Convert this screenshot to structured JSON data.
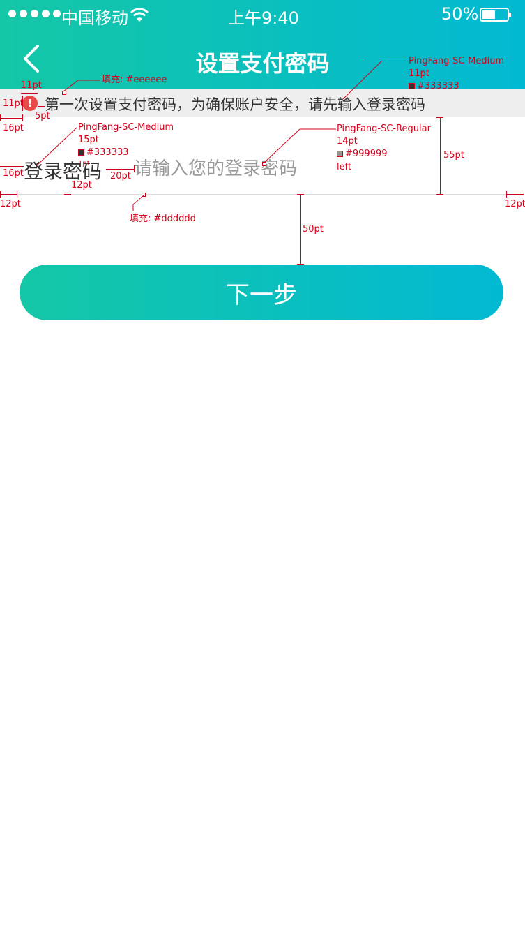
{
  "status_bar": {
    "carrier": "中国移动",
    "time": "上午9:40",
    "battery": "50%"
  },
  "nav": {
    "title": "设置支付密码"
  },
  "notice": {
    "text": "第一次设置支付密码，为确保账户安全，请先输入登录密码"
  },
  "form": {
    "label": "登录密码",
    "placeholder": "请输入您的登录密码"
  },
  "actions": {
    "next_label": "下一步"
  },
  "colors": {
    "gradient_start": "#14c7a6",
    "gradient_end": "#02b9d3",
    "notice_bg": "#eeeeee",
    "text_primary": "#333333",
    "placeholder": "#999999",
    "divider": "#dddddd",
    "annotation": "#d0021b"
  },
  "annotations": {
    "notice_font": "PingFang-SC-Medium",
    "notice_size": "11pt",
    "notice_color": "#333333",
    "label_font": "PingFang-SC-Medium",
    "label_size": "15pt",
    "label_color": "#333333",
    "input_font": "PingFang-SC-Regular",
    "input_size": "14pt",
    "input_color": "#999999",
    "input_align": "left",
    "notice_fill": "填充: #eeeeee",
    "divider_fill": "填充: #dddddd",
    "dim_icon_w": "11pt",
    "dim_icon_h": "11pt",
    "dim_icon_gap": "5pt",
    "dim_notice_left": "16pt",
    "dim_label_left": "16pt",
    "dim_label_gap": "20pt",
    "dim_label_offset": "12pt",
    "dim_row_height": "55pt",
    "dim_margin_left": "12pt",
    "dim_margin_right": "12pt",
    "dim_button_gap": "50pt",
    "overlap_note": "1pt",
    "overlap_note2": "5pt"
  }
}
